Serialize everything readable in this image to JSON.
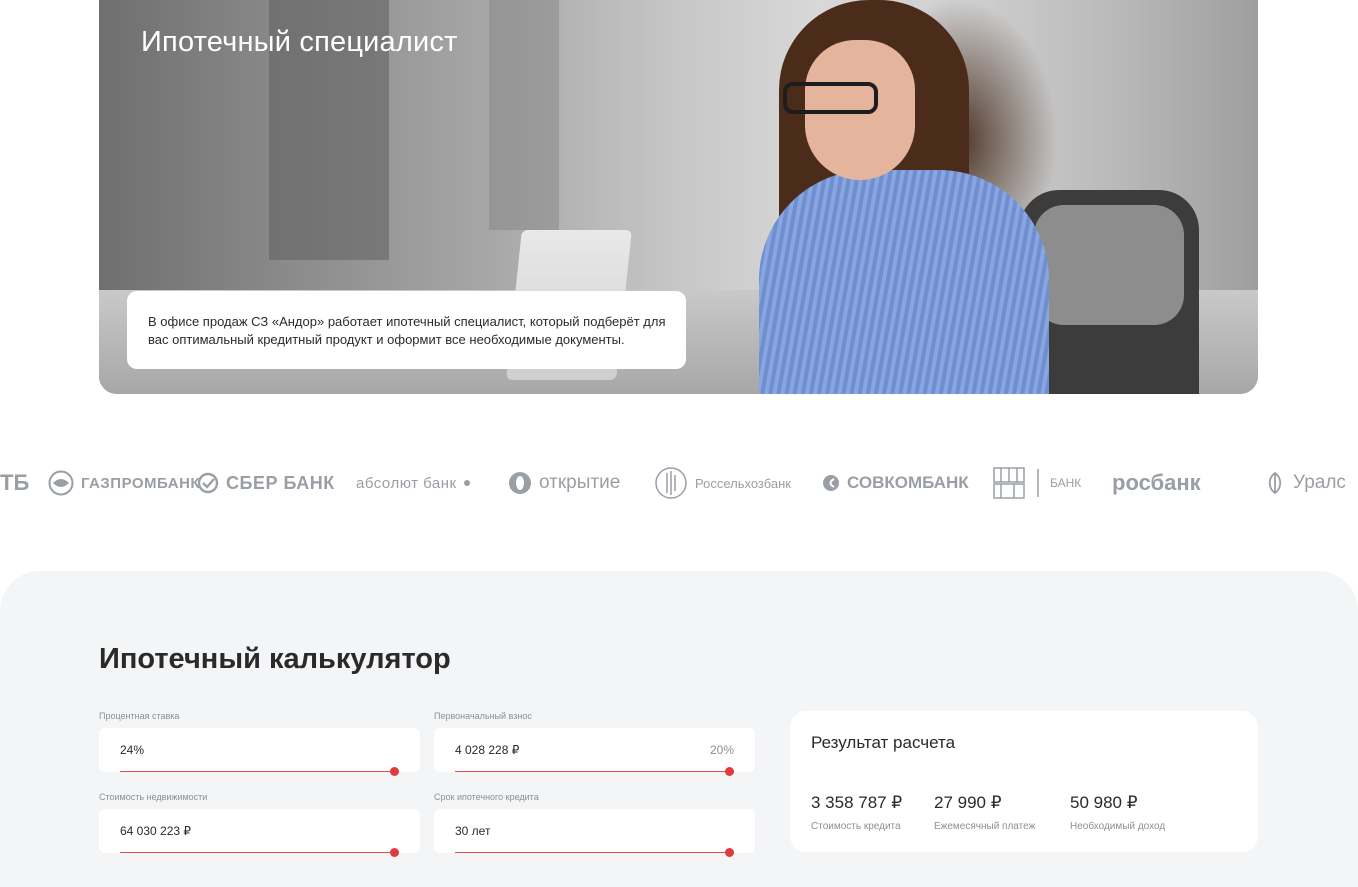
{
  "hero": {
    "title": "Ипотечный специалист",
    "description": "В офисе продаж СЗ «Андор» работает ипотечный специалист, который подберёт для вас оптимальный кредитный продукт и оформит все необходимые документы."
  },
  "banks": [
    {
      "name": "ТБ",
      "icon": "vtb-logo"
    },
    {
      "name": "ГАЗПРОМБАНК",
      "icon": "gazprombank-logo"
    },
    {
      "name": "СБЕР БАНК",
      "icon": "sber-logo"
    },
    {
      "name": "абсолют банк",
      "icon": "absolut-logo"
    },
    {
      "name": "открытие",
      "icon": "otkritie-logo"
    },
    {
      "name": "Россельхозбанк",
      "icon": "rosselkhozbank-logo"
    },
    {
      "name": "СОВКОМБАНК",
      "icon": "sovcombank-logo"
    },
    {
      "name": "БАНК",
      "icon": "dom-rf-logo"
    },
    {
      "name": "росбанк",
      "icon": "rosbank-logo"
    },
    {
      "name": "Уралс",
      "icon": "uralsib-logo"
    }
  ],
  "calculator": {
    "title": "Ипотечный калькулятор",
    "rate": {
      "label": "Процентная ставка",
      "value": "24%",
      "fill": 1.0
    },
    "down_payment": {
      "label": "Первоначальный взнос",
      "value": "4 028 228 ₽",
      "percent": "20%",
      "fill": 1.0
    },
    "property_cost": {
      "label": "Стоимость недвижимости",
      "value": "64 030 223 ₽",
      "fill": 1.0
    },
    "term": {
      "label": "Срок ипотечного кредита",
      "value": "30 лет",
      "fill": 1.0
    },
    "accent_color": "#e0393e"
  },
  "result": {
    "title": "Результат расчета",
    "credit_cost": {
      "value": "3 358 787 ₽",
      "label": "Стоимость кредита"
    },
    "monthly_payment": {
      "value": "27 990 ₽",
      "label": "Ежемесячный платеж"
    },
    "required_income": {
      "value": "50 980 ₽",
      "label": "Необходимый доход"
    }
  }
}
